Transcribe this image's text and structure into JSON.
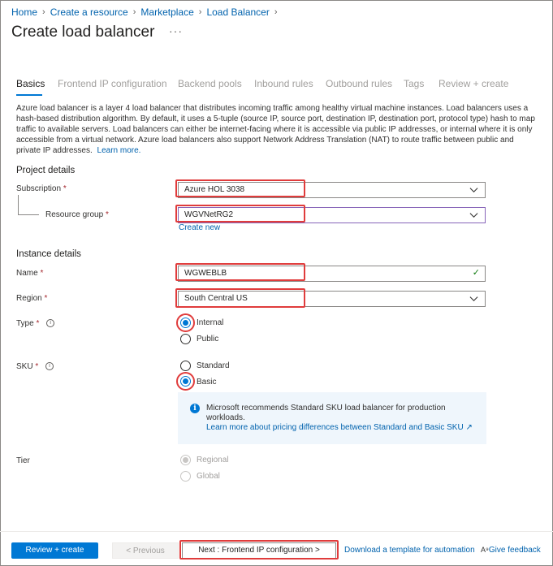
{
  "breadcrumb": [
    "Home",
    "Create a resource",
    "Marketplace",
    "Load Balancer"
  ],
  "page": {
    "title": "Create load balancer",
    "more": "···"
  },
  "tabs": [
    "Basics",
    "Frontend IP configuration",
    "Backend pools",
    "Inbound rules",
    "Outbound rules",
    "Tags",
    "Review + create"
  ],
  "description": {
    "text": "Azure load balancer is a layer 4 load balancer that distributes incoming traffic among healthy virtual machine instances. Load balancers uses a hash-based distribution algorithm. By default, it uses a 5-tuple (source IP, source port, destination IP, destination port, protocol type) hash to map traffic to available servers. Load balancers can either be internet-facing where it is accessible via public IP addresses, or internal where it is only accessible from a virtual network. Azure load balancers also support Network Address Translation (NAT) to route traffic between public and private IP addresses.",
    "link": "Learn more."
  },
  "project": {
    "heading": "Project details",
    "subscription_label": "Subscription",
    "subscription_value": "Azure HOL 3038",
    "rg_label": "Resource group",
    "rg_value": "WGVNetRG2",
    "create_new": "Create new"
  },
  "instance": {
    "heading": "Instance details",
    "name_label": "Name",
    "name_value": "WGWEBLB",
    "region_label": "Region",
    "region_value": "South Central US",
    "type_label": "Type",
    "type_options": [
      "Internal",
      "Public"
    ],
    "type_selected": "Internal",
    "sku_label": "SKU",
    "sku_options": [
      "Standard",
      "Basic"
    ],
    "sku_selected": "Basic",
    "sku_note": "Microsoft recommends Standard SKU load balancer for production workloads.",
    "sku_link": "Learn more about pricing differences between Standard and Basic SKU",
    "tier_label": "Tier",
    "tier_options": [
      "Regional",
      "Global"
    ],
    "tier_selected": "Regional"
  },
  "required_mark": "*",
  "footer": {
    "review_create": "Review + create",
    "previous": "< Previous",
    "next": "Next : Frontend IP configuration >",
    "download": "Download a template for automation",
    "feedback": "Give feedback"
  },
  "colors": {
    "accent": "#0078d4",
    "highlight": "#e03c3c",
    "link": "#0062ad",
    "success": "#107c10"
  },
  "icons": [
    "chevron-right-icon",
    "chevron-down-icon",
    "checkmark-icon",
    "info-icon",
    "external-link-icon",
    "feedback-icon"
  ]
}
